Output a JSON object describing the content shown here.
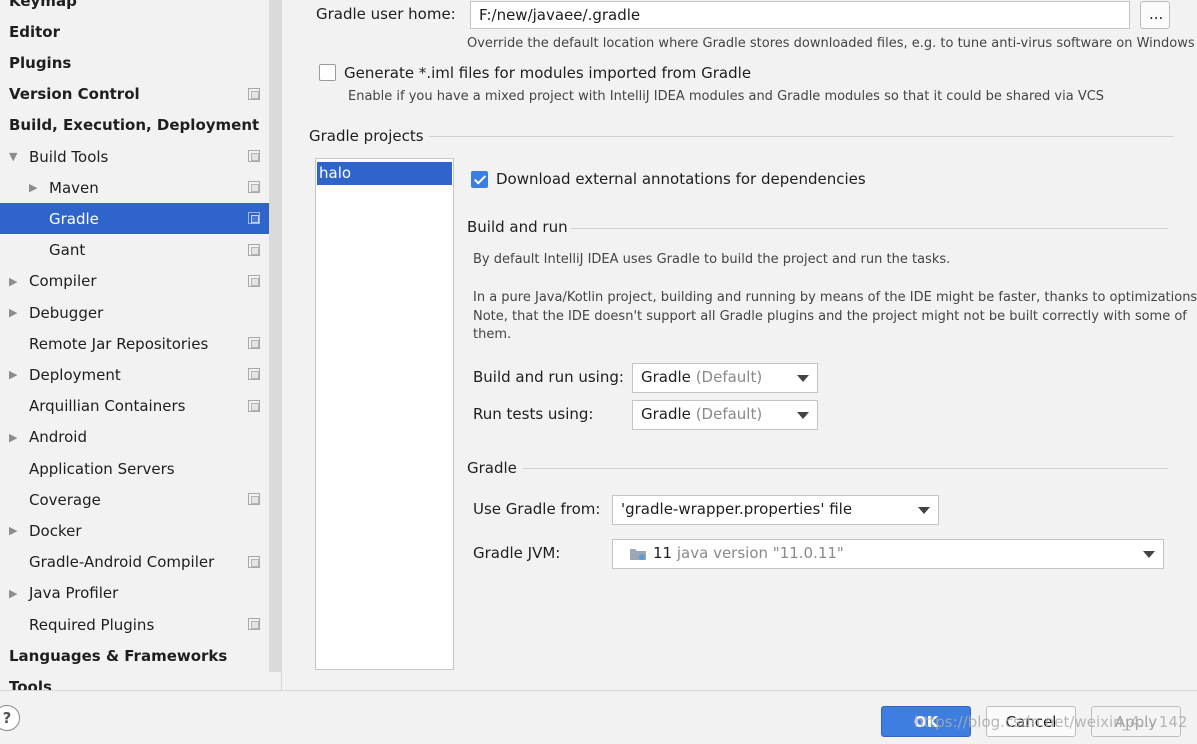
{
  "sidebar": {
    "items": [
      {
        "label": "Keymap",
        "bold": true,
        "indent": 0,
        "arrow": "",
        "project_icon": false,
        "selected": false
      },
      {
        "label": "Editor",
        "bold": true,
        "indent": 0,
        "arrow": "",
        "project_icon": false,
        "selected": false
      },
      {
        "label": "Plugins",
        "bold": true,
        "indent": 0,
        "arrow": "",
        "project_icon": false,
        "selected": false
      },
      {
        "label": "Version Control",
        "bold": true,
        "indent": 0,
        "arrow": "",
        "project_icon": true,
        "selected": false
      },
      {
        "label": "Build, Execution, Deployment",
        "bold": true,
        "indent": 0,
        "arrow": "",
        "project_icon": false,
        "selected": false
      },
      {
        "label": "Build Tools",
        "bold": false,
        "indent": 1,
        "arrow": "down",
        "project_icon": true,
        "selected": false
      },
      {
        "label": "Maven",
        "bold": false,
        "indent": 2,
        "arrow": "right",
        "project_icon": true,
        "selected": false
      },
      {
        "label": "Gradle",
        "bold": false,
        "indent": 2,
        "arrow": "",
        "project_icon": true,
        "selected": true
      },
      {
        "label": "Gant",
        "bold": false,
        "indent": 2,
        "arrow": "",
        "project_icon": true,
        "selected": false
      },
      {
        "label": "Compiler",
        "bold": false,
        "indent": 1,
        "arrow": "right",
        "project_icon": true,
        "selected": false
      },
      {
        "label": "Debugger",
        "bold": false,
        "indent": 1,
        "arrow": "right",
        "project_icon": false,
        "selected": false
      },
      {
        "label": "Remote Jar Repositories",
        "bold": false,
        "indent": 1,
        "arrow": "",
        "project_icon": true,
        "selected": false
      },
      {
        "label": "Deployment",
        "bold": false,
        "indent": 1,
        "arrow": "right",
        "project_icon": true,
        "selected": false
      },
      {
        "label": "Arquillian Containers",
        "bold": false,
        "indent": 1,
        "arrow": "",
        "project_icon": true,
        "selected": false
      },
      {
        "label": "Android",
        "bold": false,
        "indent": 1,
        "arrow": "right",
        "project_icon": false,
        "selected": false
      },
      {
        "label": "Application Servers",
        "bold": false,
        "indent": 1,
        "arrow": "",
        "project_icon": false,
        "selected": false
      },
      {
        "label": "Coverage",
        "bold": false,
        "indent": 1,
        "arrow": "",
        "project_icon": true,
        "selected": false
      },
      {
        "label": "Docker",
        "bold": false,
        "indent": 1,
        "arrow": "right",
        "project_icon": false,
        "selected": false
      },
      {
        "label": "Gradle-Android Compiler",
        "bold": false,
        "indent": 1,
        "arrow": "",
        "project_icon": true,
        "selected": false
      },
      {
        "label": "Java Profiler",
        "bold": false,
        "indent": 1,
        "arrow": "right",
        "project_icon": false,
        "selected": false
      },
      {
        "label": "Required Plugins",
        "bold": false,
        "indent": 1,
        "arrow": "",
        "project_icon": true,
        "selected": false
      },
      {
        "label": "Languages & Frameworks",
        "bold": true,
        "indent": 0,
        "arrow": "",
        "project_icon": false,
        "selected": false
      },
      {
        "label": "Tools",
        "bold": true,
        "indent": 0,
        "arrow": "",
        "project_icon": false,
        "selected": false
      }
    ]
  },
  "main": {
    "gradle_user_home_label": "Gradle user home:",
    "gradle_user_home_value": "F:/new/javaee/.gradle",
    "browse_label": "...",
    "gradle_user_home_hint": "Override the default location where Gradle stores downloaded files, e.g. to tune anti-virus software on Windows",
    "generate_iml_label": "Generate *.iml files for modules imported from Gradle",
    "generate_iml_checked": false,
    "generate_iml_hint": "Enable if you have a mixed project with IntelliJ IDEA modules and Gradle modules so that it could be shared via VCS",
    "gradle_projects_title": "Gradle projects",
    "projects": [
      "halo"
    ],
    "download_annotations_label": "Download external annotations for dependencies",
    "download_annotations_checked": true,
    "build_and_run_title": "Build and run",
    "build_desc_1": "By default IntelliJ IDEA uses Gradle to build the project and run the tasks.",
    "build_desc_2": "In a pure Java/Kotlin project, building and running by means of the IDE might be faster, thanks to optimizations.",
    "build_desc_3": "Note, that the IDE doesn't support all Gradle plugins and the project might not be built correctly with some of",
    "build_desc_4": "them.",
    "build_run_using_label": "Build and run using:",
    "build_run_using_value": "Gradle",
    "build_run_using_suffix": "(Default)",
    "run_tests_using_label": "Run tests using:",
    "run_tests_using_value": "Gradle",
    "run_tests_using_suffix": "(Default)",
    "gradle_section_title": "Gradle",
    "use_gradle_from_label": "Use Gradle from:",
    "use_gradle_from_value": "'gradle-wrapper.properties' file",
    "gradle_jvm_label": "Gradle JVM:",
    "gradle_jvm_version": "11",
    "gradle_jvm_detail": "java version \"11.0.11\""
  },
  "footer": {
    "help_label": "?",
    "ok_label": "OK",
    "cancel_label": "Cancel",
    "apply_label": "Apply",
    "watermark": "https://blog.csdn.net/weixin_4... 142"
  },
  "colors": {
    "accent": "#2f65ca",
    "ok_button": "#3d7ee0",
    "background": "#f2f2f2"
  }
}
